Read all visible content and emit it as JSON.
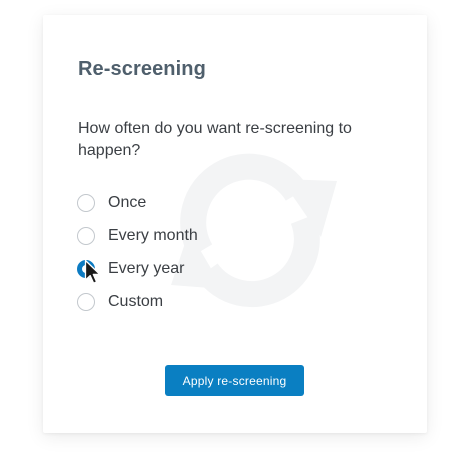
{
  "dialog": {
    "title": "Re-screening",
    "question": "How often do you want re-screening to happen?",
    "options": [
      {
        "label": "Once",
        "selected": false
      },
      {
        "label": "Every month",
        "selected": false
      },
      {
        "label": "Every year",
        "selected": true
      },
      {
        "label": "Custom",
        "selected": false
      }
    ],
    "apply_label": "Apply re-screening"
  },
  "colors": {
    "accent": "#0a7fc2",
    "title": "#4f5f6c",
    "text": "#3b3f44",
    "radio_border": "#c3c8cd",
    "watermark": "#f4f5f6"
  },
  "icons": {
    "watermark": "refresh-icon",
    "pointer": "mouse-pointer-icon"
  }
}
